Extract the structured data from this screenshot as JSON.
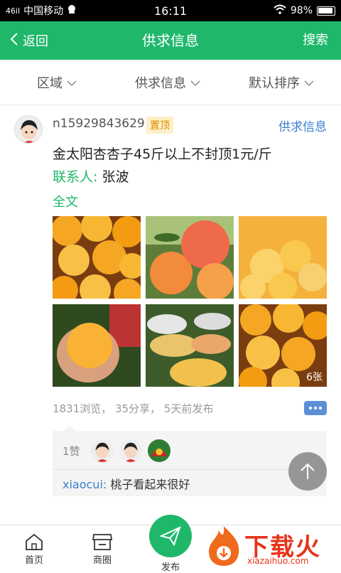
{
  "statusbar": {
    "signal": "46il",
    "carrier": "中国移动",
    "time": "16:11",
    "battery": "98%"
  },
  "nav": {
    "back": "返回",
    "title": "供求信息",
    "search": "搜索"
  },
  "filters": [
    {
      "label": "区域"
    },
    {
      "label": "供求信息"
    },
    {
      "label": "默认排序"
    }
  ],
  "post": {
    "username": "n15929843629",
    "tag": "置顶",
    "category": "供求信息",
    "content": "金太阳杏杏子45斤以上不封顶1元/斤",
    "contact_label": "联系人:",
    "contact_name": "张波",
    "fulltext": "全文",
    "photo_count": "6张",
    "meta": "1831浏览， 35分享， 5天前发布",
    "likes": "1赞",
    "comment_user": "xiaocui:",
    "comment_text": "桃子看起来很好"
  },
  "tabbar": {
    "home": "首页",
    "shops": "商圈",
    "publish": "发布"
  },
  "watermark": {
    "text": "下载火",
    "url": "xiazaihuo.com"
  },
  "colors": {
    "brand": "#1fb86b",
    "link": "#3a7fd0",
    "tag_bg": "#fdf0c8",
    "tag_text": "#e08a00",
    "watermark": "#e8331b"
  }
}
